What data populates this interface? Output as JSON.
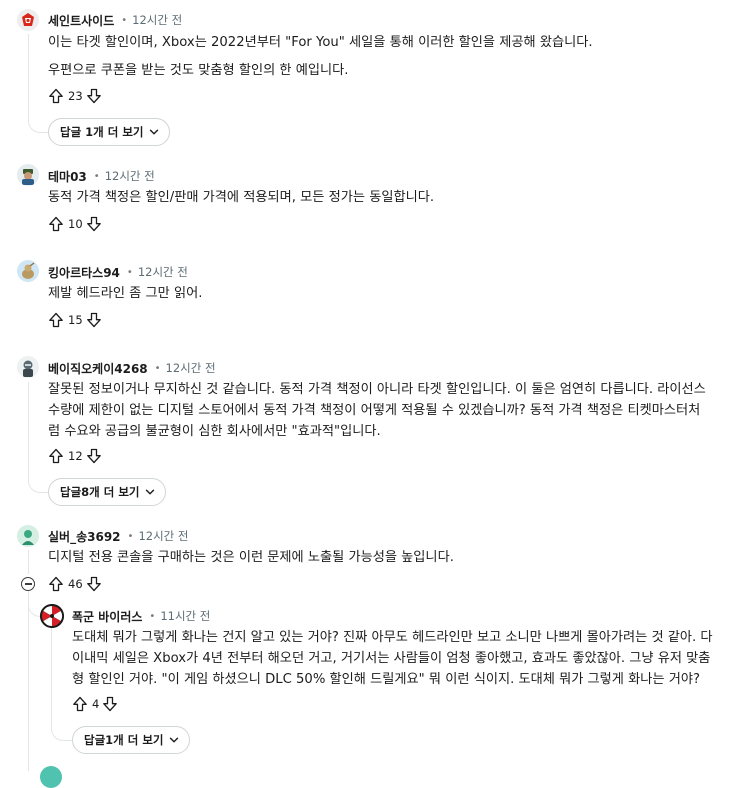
{
  "comments": [
    {
      "author": "세인트사이드",
      "time": "12시간 전",
      "lines": [
        "이는 타겟 할인이며, Xbox는 2022년부터 \"For You\" 세일을 통해 이러한 할인을 제공해 왔습니다.",
        "우편으로 쿠폰을 받는 것도 맞춤형 할인의 한 예입니다."
      ],
      "votes": "23",
      "replies_label": "답글 1개 더 보기"
    },
    {
      "author": "테마03",
      "time": "12시간 전",
      "lines": [
        "동적 가격 책정은 할인/판매 가격에 적용되며, 모든 정가는 동일합니다."
      ],
      "votes": "10"
    },
    {
      "author": "킹아르타스94",
      "time": "12시간 전",
      "lines": [
        "제발 헤드라인 좀 그만 읽어."
      ],
      "votes": "15"
    },
    {
      "author": "베이직오케이4268",
      "time": "12시간 전",
      "lines": [
        "잘못된 정보이거나 무지하신 것 같습니다. 동적 가격 책정이 아니라 타겟 할인입니다. 이 둘은 엄연히 다릅니다. 라이선스",
        "수량에 제한이 없는 디지털 스토어에서 동적 가격 책정이 어떻게 적용될 수 있겠습니까? 동적 가격 책정은 티켓마스터처",
        "럼 수요와 공급의 불균형이 심한 회사에서만 \"효과적\"입니다."
      ],
      "votes": "12",
      "replies_label": "답글8개 더 보기"
    },
    {
      "author": "실버_송3692",
      "time": "12시간 전",
      "lines": [
        "디지털 전용 콘솔을 구매하는 것은 이런 문제에 노출될 가능성을 높입니다."
      ],
      "votes": "46"
    },
    {
      "author": "폭군 바이러스",
      "time": "11시간 전",
      "lines": [
        "도대체 뭐가 그렇게 화나는 건지 알고 있는 거야? 진짜 아무도 헤드라인만 보고 소니만 나쁘게 몰아가려는 것 같아. 다",
        "이내믹 세일은 Xbox가 4년 전부터 해오던 거고, 거기서는 사람들이 엄청 좋아했고, 효과도 좋았잖아. 그냥 유저 맞춤",
        "형 할인인 거야. \"이 게임 하셨으니 DLC 50% 할인해 드릴게요\" 뭐 이런 식이지. 도대체 뭐가 그렇게 화나는 거야?"
      ],
      "votes": "4",
      "replies_label": "답글1개 더 보기"
    }
  ],
  "icons": {
    "upvote": "arrow-up-outline",
    "downvote": "arrow-down-outline",
    "expand": "chevron-down",
    "collapse": "minus-circle"
  },
  "colors": {
    "text": "#1c1c1c",
    "meta": "#5c6c74",
    "border": "#d0d5d8",
    "thread_line": "#e3e6e8"
  }
}
